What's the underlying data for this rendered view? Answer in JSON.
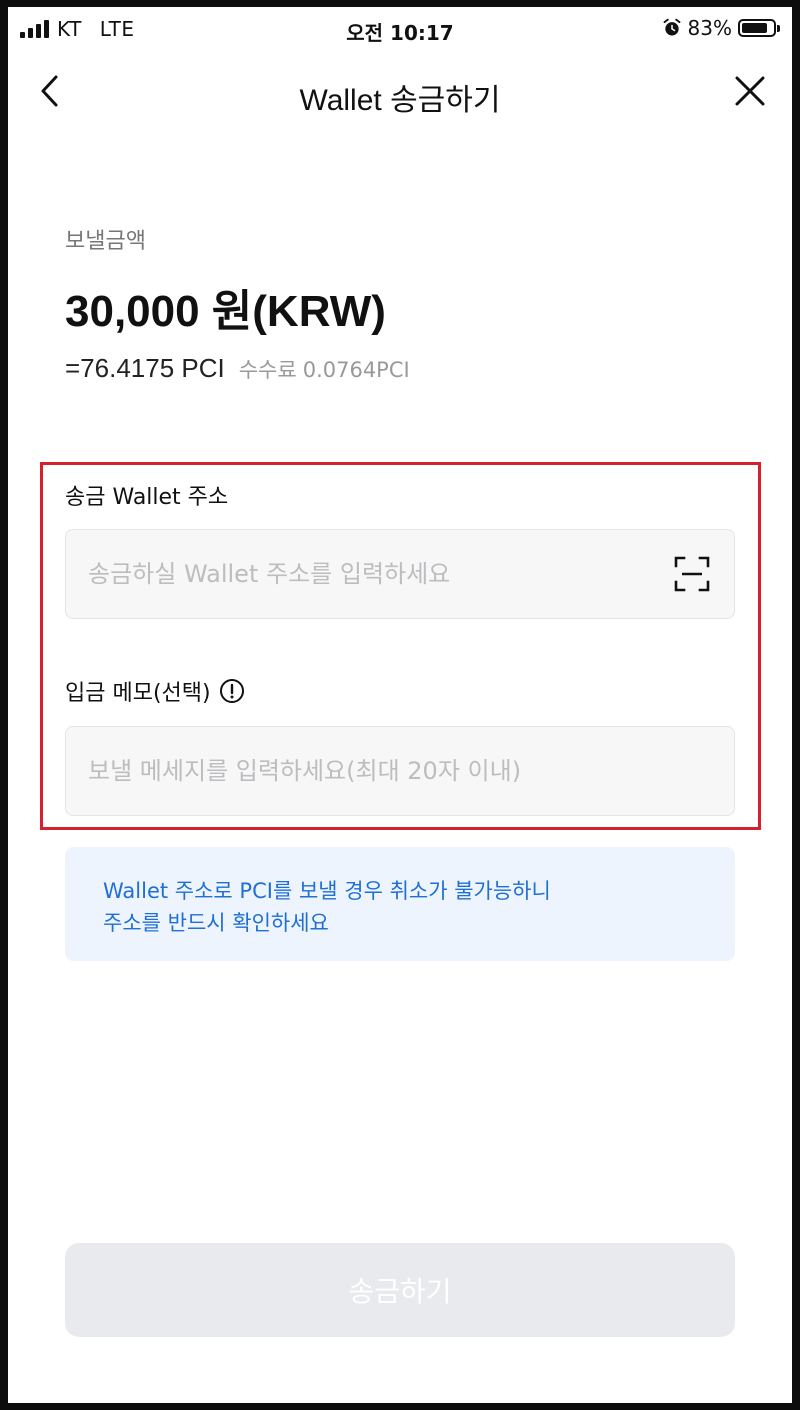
{
  "status_bar": {
    "carrier": "KT",
    "network": "LTE",
    "time": "오전 10:17",
    "battery": "83%",
    "battery_level": 0.83,
    "icons": [
      "signal-icon",
      "alarm-icon",
      "battery-icon"
    ]
  },
  "header": {
    "title": "Wallet 송금하기",
    "back_icon": "chevron-left-icon",
    "close_icon": "close-icon"
  },
  "amount": {
    "label": "보낼금액",
    "krw": "30,000 원(KRW)",
    "pci": "=76.4175 PCI",
    "fee_label": "수수료",
    "fee_value": "0.0764PCI"
  },
  "form": {
    "address_label": "송금 Wallet 주소",
    "address_placeholder": "송금하실 Wallet 주소를 입력하세요",
    "address_value": "",
    "scan_icon": "qr-scan-icon",
    "memo_label": "입금 메모(선택)",
    "memo_info_icon": "info-icon",
    "memo_placeholder": "보낼 메세지를 입력하세요(최대 20자 이내)",
    "memo_value": ""
  },
  "notice": {
    "line1": "Wallet 주소로 PCI를 보낼 경우 취소가 불가능하니",
    "line2": "주소를 반드시 확인하세요"
  },
  "submit": {
    "label": "송금하기",
    "enabled": false
  },
  "colors": {
    "highlight_border": "#d5202e",
    "notice_text": "#1f6fd6",
    "notice_bg": "#eef4fd",
    "button_disabled_bg": "#e9eaed"
  }
}
